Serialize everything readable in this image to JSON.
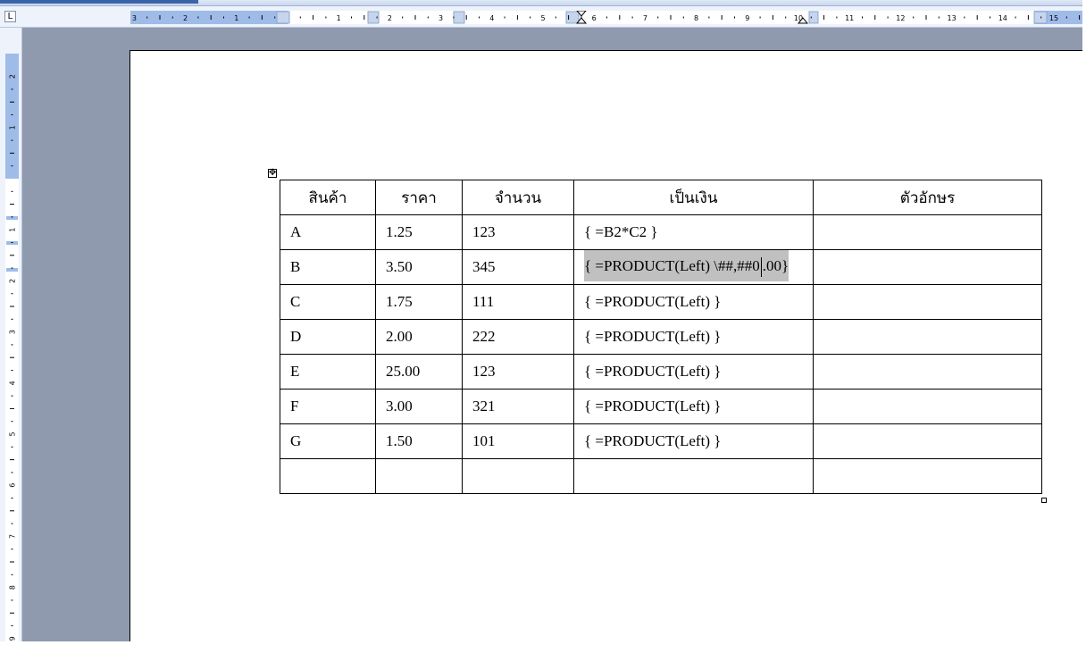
{
  "ruler": {
    "tab_selector": "L",
    "h_labels": [
      "3",
      "2",
      "1",
      "1",
      "2",
      "3",
      "4",
      "5",
      "6",
      "7",
      "8",
      "9",
      "10",
      "11",
      "12",
      "13",
      "14",
      "15"
    ],
    "v_labels": [
      "2",
      "1",
      "1",
      "2",
      "3",
      "4",
      "5",
      "6",
      "7",
      "8",
      "9"
    ]
  },
  "table": {
    "headers": [
      "สินค้า",
      "ราคา",
      "จำนวน",
      "เป็นเงิน",
      "ตัวอักษร"
    ],
    "rows": [
      [
        "A",
        "1.25",
        "123",
        "{ =B2*C2 }",
        ""
      ],
      [
        "B",
        "3.50",
        "345",
        "{ =PRODUCT(Left) \\##,##0.00}",
        ""
      ],
      [
        "C",
        "1.75",
        "111",
        "{ =PRODUCT(Left) }",
        ""
      ],
      [
        "D",
        "2.00",
        "222",
        "{ =PRODUCT(Left) }",
        ""
      ],
      [
        "E",
        "25.00",
        "123",
        "{ =PRODUCT(Left) }",
        ""
      ],
      [
        "F",
        "3.00",
        "321",
        "{ =PRODUCT(Left) }",
        ""
      ],
      [
        "G",
        "1.50",
        "101",
        "{ =PRODUCT(Left) }",
        ""
      ],
      [
        "",
        "",
        "",
        "",
        ""
      ]
    ],
    "selected_field": {
      "before_caret": "{ =PRODUCT(Left) \\##,##0",
      "after_caret": ".00}"
    }
  }
}
